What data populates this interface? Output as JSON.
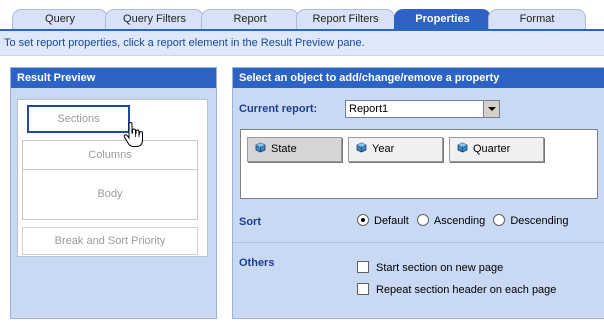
{
  "tabs": [
    {
      "label": "Query",
      "active": false
    },
    {
      "label": "Query Filters",
      "active": false
    },
    {
      "label": "Report",
      "active": false
    },
    {
      "label": "Report Filters",
      "active": false
    },
    {
      "label": "Properties",
      "active": true
    },
    {
      "label": "Format",
      "active": false
    }
  ],
  "hint_text": "To set report properties, click a report element in the Result Preview pane.",
  "result_preview": {
    "title": "Result Preview",
    "sections": "Sections",
    "columns": "Columns",
    "body": "Body",
    "break_sort": "Break and Sort Priority"
  },
  "properties": {
    "title": "Select an object to add/change/remove a property",
    "current_report_label": "Current report:",
    "current_report_value": "Report1",
    "objects": [
      {
        "label": "State",
        "selected": true
      },
      {
        "label": "Year",
        "selected": false
      },
      {
        "label": "Quarter",
        "selected": false
      }
    ],
    "sort_label": "Sort",
    "sort_options": [
      {
        "label": "Default",
        "checked": true
      },
      {
        "label": "Ascending",
        "checked": false
      },
      {
        "label": "Descending",
        "checked": false
      }
    ],
    "others_label": "Others",
    "checkboxes": [
      {
        "label": "Start section on new page",
        "checked": false
      },
      {
        "label": "Repeat section header on each page",
        "checked": false
      }
    ]
  },
  "colors": {
    "accent": "#2c63c5",
    "pane_bg": "#c9d9f3",
    "label_blue": "#1d3f8f",
    "hint_text": "#17469e"
  },
  "icons": {
    "object": "cube-icon",
    "cursor": "hand-pointer-icon"
  }
}
